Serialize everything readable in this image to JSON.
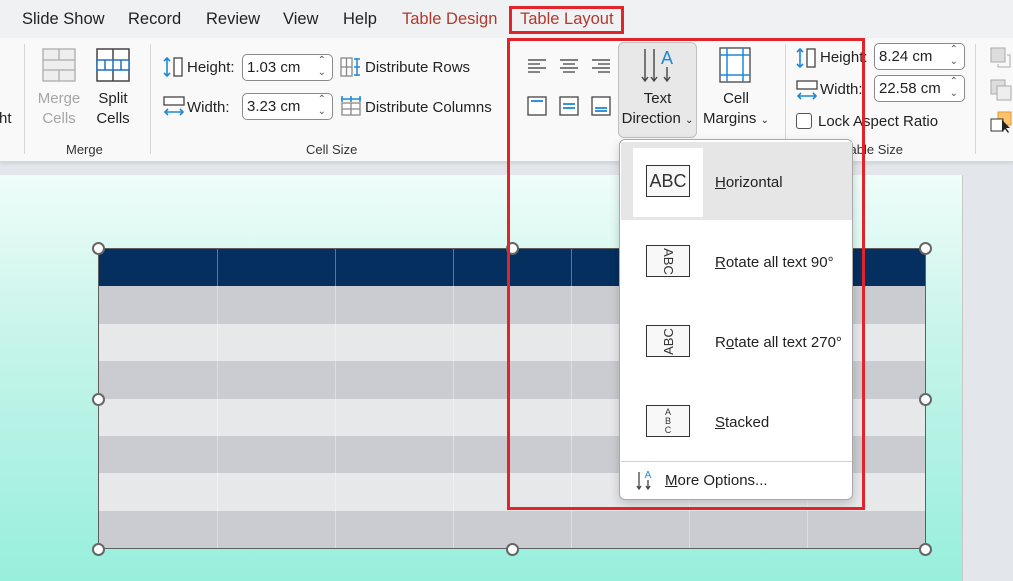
{
  "menubar": {
    "tabs": [
      {
        "label": "Slide Show"
      },
      {
        "label": "Record"
      },
      {
        "label": "Review"
      },
      {
        "label": "View"
      },
      {
        "label": "Help"
      },
      {
        "label": "Table Design"
      },
      {
        "label": "Table Layout"
      }
    ],
    "active_tab": "Table Layout"
  },
  "ribbon": {
    "partial_left_label": "ht",
    "merge_group": {
      "label": "Merge",
      "merge_cells": {
        "line1": "Merge",
        "line2": "Cells",
        "enabled": false
      },
      "split_cells": {
        "line1": "Split",
        "line2": "Cells"
      }
    },
    "cell_size_group": {
      "label": "Cell Size",
      "height_label": "Height:",
      "height_value": "1.03 cm",
      "width_label": "Width:",
      "width_value": "3.23 cm",
      "distribute_rows": "Distribute Rows",
      "distribute_columns": "Distribute Columns"
    },
    "alignment_group": {
      "text_direction": {
        "line1": "Text",
        "line2": "Direction"
      },
      "cell_margins": {
        "line1": "Cell",
        "line2": "Margins"
      }
    },
    "table_size_group": {
      "label": "Table Size",
      "height_label": "Height:",
      "height_value": "8.24 cm",
      "width_label": "Width:",
      "width_value": "22.58 cm",
      "lock_aspect_ratio": "Lock Aspect Ratio",
      "lock_aspect_checked": false
    }
  },
  "text_direction_menu": {
    "items": [
      {
        "label_underline": "H",
        "label_rest": "orizontal",
        "thumb": "ABC",
        "selected": true
      },
      {
        "label_underline": "R",
        "label_rest": "otate all text 90°",
        "thumb": "ABC",
        "selected": false
      },
      {
        "label_prefix": "R",
        "label_underline": "o",
        "label_rest": "tate all text 270°",
        "thumb": "ABC",
        "selected": false
      },
      {
        "label_underline": "S",
        "label_rest": "tacked",
        "thumb": "A B C",
        "selected": false
      }
    ],
    "more_options": {
      "label_underline": "M",
      "label_rest": "ore Options..."
    }
  },
  "table": {
    "columns": 7,
    "rows": 8,
    "header_color": "#052f5f",
    "band_dark": "#cbccd1",
    "band_light": "#e7e8ea"
  },
  "colors": {
    "accent_red": "#e0242a",
    "contextual_tab": "#b03a2e",
    "icon_blue": "#1e88d6"
  }
}
